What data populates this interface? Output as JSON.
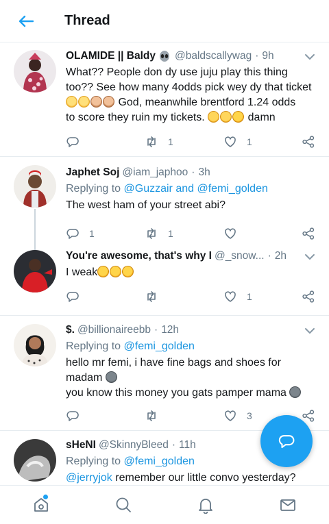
{
  "header": {
    "title": "Thread"
  },
  "colors": {
    "accent": "#1da1f2",
    "link": "#1b95e0",
    "muted": "#657786"
  },
  "tweets": [
    {
      "name": "OLAMIDE || Baldy",
      "name_emoji": "alien-icon",
      "handle": "@baldscallywag",
      "time": "9h",
      "text_line1": "What?? People don dy use juju play this thing",
      "text_line2": "too?? See how many 4odds pick wey dy that ticket",
      "text_line3": "God, meanwhile brentford 1.24 odds",
      "text_line4": "to score they ruin my tickets.",
      "text_line4_end": "damn",
      "replies": "",
      "retweets": "1",
      "likes": "1"
    },
    {
      "name": "Japhet Soj",
      "handle": "@iam_japhoo",
      "time": "3h",
      "replying_prefix": "Replying to",
      "replying_to": "@Guzzair and @femi_golden",
      "text": "The west ham of your street abi?",
      "replies": "1",
      "retweets": "1",
      "likes": ""
    },
    {
      "name": "You're awesome, that's why I",
      "handle": "@_snow...",
      "time": "2h",
      "text": "I weak",
      "replies": "",
      "retweets": "",
      "likes": "1"
    },
    {
      "name": "$.",
      "handle": "@billionaireebb",
      "time": "12h",
      "replying_prefix": "Replying to",
      "replying_to": "@femi_golden",
      "text_line1": "hello mr femi, i have fine bags and shoes for",
      "text_line2": "madam",
      "text_line3": "you know this money you gats pamper mama",
      "replies": "",
      "retweets": "",
      "likes": "3"
    },
    {
      "name": "sHeNI",
      "handle": "@SkinnyBleed",
      "time": "11h",
      "replying_prefix": "Replying to",
      "replying_to": "@femi_golden",
      "mention": "@jerryjok",
      "text": " remember our little convo yesterday?"
    }
  ],
  "nav": {
    "items": [
      "home-icon",
      "search-icon",
      "notifications-icon",
      "messages-icon"
    ]
  }
}
